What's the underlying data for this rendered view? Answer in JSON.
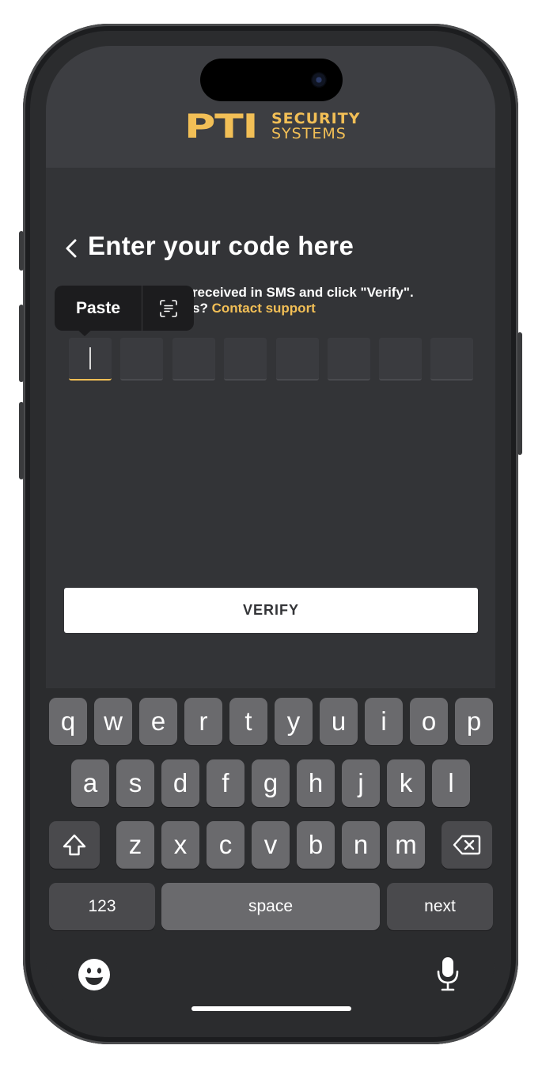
{
  "brand": {
    "logo_main": "PTI",
    "logo_line1": "SECURITY",
    "logo_line2": "SYSTEMS",
    "accent_color": "#f2bf56"
  },
  "page": {
    "title": "Enter your code here",
    "instruction_visible": "ode received in SMS and click \"Verify\".",
    "help_visible_fragment": "s?",
    "support_link": "Contact support",
    "back_icon": "chevron-left-icon"
  },
  "code_input": {
    "length": 8,
    "active_index": 0,
    "values": [
      "",
      "",
      "",
      "",
      "",
      "",
      "",
      ""
    ]
  },
  "context_menu": {
    "paste_label": "Paste",
    "scan_icon": "scan-text-icon"
  },
  "verify_button": {
    "label": "VERIFY"
  },
  "keyboard": {
    "row1": [
      "q",
      "w",
      "e",
      "r",
      "t",
      "y",
      "u",
      "i",
      "o",
      "p"
    ],
    "row2": [
      "a",
      "s",
      "d",
      "f",
      "g",
      "h",
      "j",
      "k",
      "l"
    ],
    "row3": [
      "z",
      "x",
      "c",
      "v",
      "b",
      "n",
      "m"
    ],
    "shift_icon": "shift-icon",
    "delete_icon": "backspace-icon",
    "numbers_label": "123",
    "space_label": "space",
    "return_label": "next",
    "emoji_icon": "emoji-icon",
    "mic_icon": "microphone-icon"
  }
}
